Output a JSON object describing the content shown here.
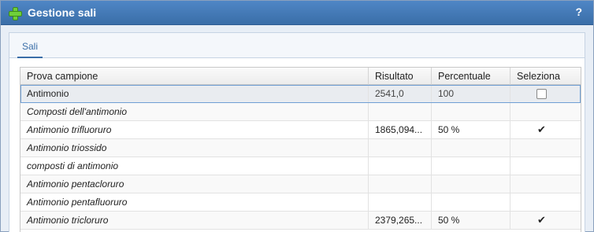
{
  "window": {
    "title": "Gestione sali",
    "help_label": "?"
  },
  "tabs": [
    {
      "label": "Sali"
    }
  ],
  "grid": {
    "columns": [
      "Prova campione",
      "Risultato",
      "Percentuale",
      "Seleziona"
    ],
    "rows": [
      {
        "name": "Antimonio",
        "risultato": "2541,0",
        "percentuale": "100",
        "seleziona": "checkbox",
        "italic": false,
        "selected": true
      },
      {
        "name": "Composti dell'antimonio",
        "risultato": "",
        "percentuale": "",
        "seleziona": "",
        "italic": true,
        "selected": false
      },
      {
        "name": "Antimonio trifluoruro",
        "risultato": "1865,094...",
        "percentuale": "50 %",
        "seleziona": "✔",
        "italic": true,
        "selected": false
      },
      {
        "name": "Antimonio triossido",
        "risultato": "",
        "percentuale": "",
        "seleziona": "",
        "italic": true,
        "selected": false
      },
      {
        "name": "composti di antimonio",
        "risultato": "",
        "percentuale": "",
        "seleziona": "",
        "italic": true,
        "selected": false
      },
      {
        "name": "Antimonio pentacloruro",
        "risultato": "",
        "percentuale": "",
        "seleziona": "",
        "italic": true,
        "selected": false
      },
      {
        "name": "Antimonio pentafluoruro",
        "risultato": "",
        "percentuale": "",
        "seleziona": "",
        "italic": true,
        "selected": false
      },
      {
        "name": "Antimonio tricloruro",
        "risultato": "2379,265...",
        "percentuale": "50 %",
        "seleziona": "✔",
        "italic": true,
        "selected": false
      }
    ]
  }
}
